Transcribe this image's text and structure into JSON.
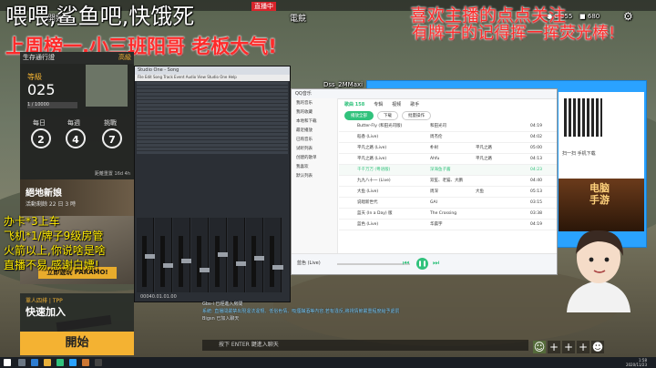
{
  "overlay": {
    "top_left": "喂喂,鲨鱼吧,快饿死",
    "red_banner": "上周榜一,小三班阳哥 老板大气!",
    "top_right_1": "喜欢主播的点点关注",
    "top_right_2": "有牌子的记得挥一挥荧光棒!",
    "promo_1": "办卡*3上车",
    "promo_2": "飞机*1/牌子9级房管",
    "promo_3": "火箭以上,你说啥是啥",
    "promo_4": "直播不易,感谢白嫖!",
    "live_badge": "直播中",
    "top_hud_labels": [
      "開始",
      "電競"
    ]
  },
  "hud": {
    "currency_1": "0.055",
    "currency_2": "680",
    "settings_icon": "gear-icon"
  },
  "pass": {
    "title": "生存通行證",
    "badge": "高級",
    "tier_label": "等級",
    "tier_value": "025",
    "xp": "1 / 10000",
    "missions": [
      {
        "label": "每日",
        "count": "2"
      },
      {
        "label": "每週",
        "count": "4"
      },
      {
        "label": "挑戰",
        "count": "7"
      }
    ],
    "reset_note": "距離重置 16d 4h"
  },
  "bride": {
    "title": "絕地新娘",
    "subtitle": "活動剩餘 22 日 3 時"
  },
  "paramo": {
    "button": "立即遊玩 PARAMO!"
  },
  "quick": {
    "mode": "單人四排 | TPP",
    "title": "快速加入",
    "start": "開始"
  },
  "mixer": {
    "title": "Studio One - Song",
    "menu": "File  Edit  Song  Track  Event  Audio  View  Studio One  Help",
    "clock": "00040.01.01.00"
  },
  "player": {
    "title": "QQ音乐",
    "side_items": [
      "我的音乐",
      "我的收藏",
      "本地和下载",
      "最近播放",
      "已购音乐",
      "试听列表",
      "创建的歌单",
      "我喜欢",
      "默认列表"
    ],
    "tabs": [
      "歌曲 158",
      "专辑",
      "视频",
      "歌手"
    ],
    "buttons": [
      "播放全部",
      "下载",
      "批量操作"
    ],
    "songs": [
      {
        "name": "Butter-Fly (和田光司版)",
        "artist": "和田光司",
        "album": "",
        "duration": "04:19"
      },
      {
        "name": "稻香 (Live)",
        "artist": "周杰伦",
        "album": "",
        "duration": "04:02"
      },
      {
        "name": "平凡之路 (Live)",
        "artist": "朴树",
        "album": "平凡之路",
        "duration": "05:00"
      },
      {
        "name": "平凡之路 (Live)",
        "artist": "Ahfu",
        "album": "平凡之路",
        "duration": "04:13"
      },
      {
        "name": "千千万万 (粤语版)",
        "artist": "深海鱼子酱",
        "album": "",
        "duration": "04:23"
      },
      {
        "name": "九九八十一 (Live)",
        "artist": "双笙、老猫、大鹏",
        "album": "",
        "duration": "04:40"
      },
      {
        "name": "大鱼 (Live)",
        "artist": "周深",
        "album": "大鱼",
        "duration": "05:13"
      },
      {
        "name": "说唱新世代",
        "artist": "GAI",
        "album": "",
        "duration": "03:15"
      },
      {
        "name": "蓝天 (In a Day) 版",
        "artist": "The Crossing",
        "album": "",
        "duration": "03:38"
      },
      {
        "name": "蓝色 (Live)",
        "artist": "华晨宇",
        "album": "",
        "duration": "04:19"
      }
    ],
    "now_playing": "蓝色 (Live)"
  },
  "blue_client": {
    "user": "Dss_2MMaxi",
    "ad_text_1": "电脑",
    "ad_text_2": "手游",
    "ad_note": "扫一扫 手机下载"
  },
  "chat": {
    "messages": [
      "Gbs-i 已經進入房間",
      "系統: 直播間嚴禁出現違法違規、低俗色情、吸煙酗酒等內容,若有違反,將視情節嚴重程度給予處罰",
      "Bigsn 已加入聊天"
    ],
    "input_placeholder": "按下 ENTER 鍵進入聊天"
  },
  "taskbar": {
    "time": "1:58",
    "date": "2020/11/23"
  }
}
